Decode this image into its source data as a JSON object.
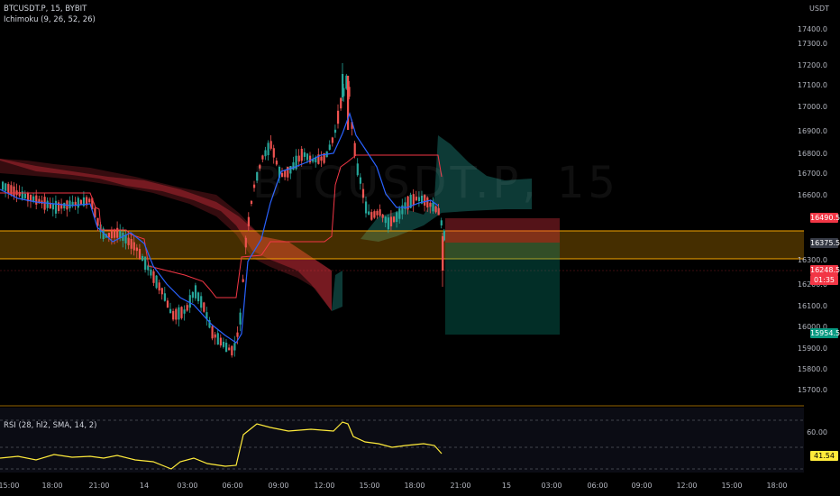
{
  "symbol_line": "BTCUSDT.P, 15, BYBIT",
  "indicator_line": "Ichimoku (9, 26, 52, 26)",
  "rsi_legend": "RSI (28, hl2, SMA, 14, 2)",
  "axis_unit": "USDT",
  "watermark": "BTCUSDT.P, 15",
  "price_axis": [
    "17400.0",
    "17300.0",
    "17200.0",
    "17100.0",
    "17000.0",
    "16900.0",
    "16800.0",
    "16700.0",
    "16600.0",
    "16300.0",
    "16200.0",
    "16100.0",
    "16000.0",
    "15900.0",
    "15800.0",
    "15700.0"
  ],
  "badges": {
    "stop_price": "16490.5",
    "entry_price": "16375.5",
    "last_price": "16248.5",
    "countdown": "01:35",
    "target_price": "15954.5",
    "rsi_value": "41.54"
  },
  "rsi_axis": "60.00",
  "time_axis": [
    "15:00",
    "18:00",
    "21:00",
    "14",
    "03:00",
    "06:00",
    "09:00",
    "12:00",
    "15:00",
    "18:00",
    "21:00",
    "15",
    "03:00",
    "06:00",
    "09:00",
    "12:00",
    "15:00",
    "18:00"
  ],
  "colors": {
    "up": "#26a69a",
    "down": "#ef5350",
    "tenkan": "#2962ff",
    "kijun": "#f23645",
    "zone": "#f7a600",
    "rsi": "#ffeb3b",
    "badge_red": "#f23645",
    "badge_green": "#089981",
    "badge_gray": "#363a45"
  }
}
